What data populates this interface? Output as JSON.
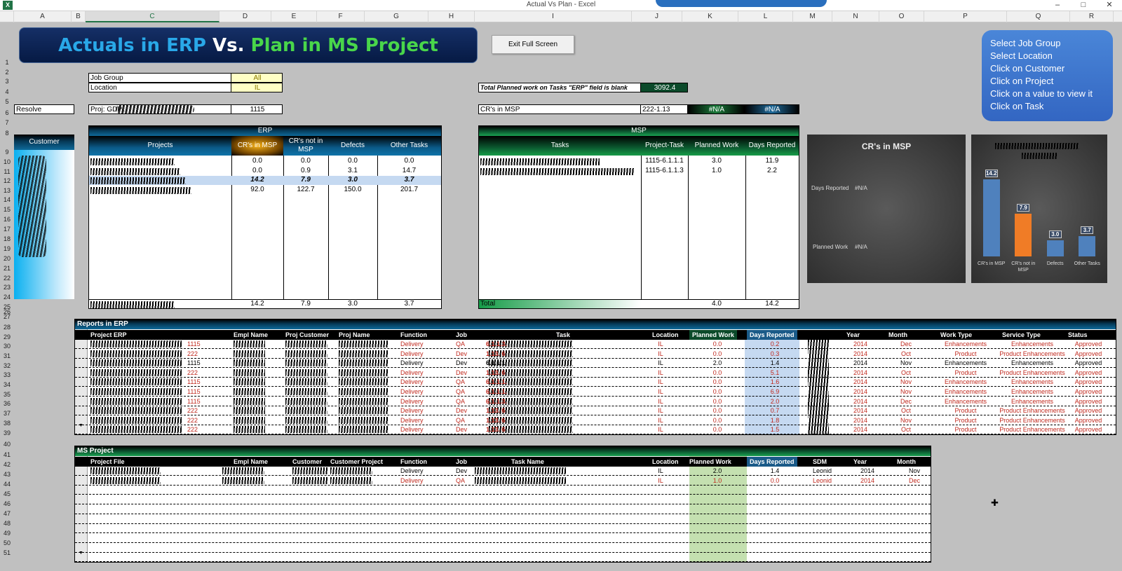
{
  "window": {
    "title": "Actual Vs Plan - Excel"
  },
  "columns": [
    "A",
    "B",
    "C",
    "D",
    "E",
    "F",
    "G",
    "H",
    "I",
    "J",
    "K",
    "L",
    "M",
    "N",
    "O",
    "P",
    "Q",
    "R"
  ],
  "rows": [
    "1",
    "2",
    "3",
    "4",
    "5",
    "6",
    "7",
    "8",
    "9",
    "10",
    "11",
    "12",
    "13",
    "14",
    "15",
    "16",
    "17",
    "18",
    "19",
    "20",
    "21",
    "22",
    "23",
    "24",
    "25",
    "26",
    "27",
    "28",
    "29",
    "30",
    "31",
    "32",
    "33",
    "34",
    "35",
    "36",
    "37",
    "38",
    "39",
    "40",
    "41",
    "42",
    "43",
    "44",
    "45",
    "46",
    "47",
    "48",
    "49",
    "50",
    "51"
  ],
  "banner": {
    "part1": "Actuals in ERP",
    "part2": "Vs.",
    "part3": "Plan in MS Project"
  },
  "exit_button": "Exit Full Screen",
  "instructions": [
    "Select Job Group",
    "Select Location",
    "Click on Customer",
    "Click on Project",
    "Click on a value to view it",
    "Click on Task"
  ],
  "filters": {
    "job_group_label": "Job Group",
    "job_group_value": "All",
    "location_label": "Location",
    "location_value": "IL",
    "row6_a": "Resolve",
    "row6_c": "Proj: GDP...",
    "row6_d": "1115"
  },
  "planned_blank": {
    "label": "Total Planned work on Tasks \"ERP\" field is blank",
    "value": "3092.4"
  },
  "crs_msp": {
    "label": "CR's in MSP",
    "code": "222-1.13",
    "na1": "#N/A",
    "na2": "#N/A"
  },
  "customer_header": "Customer",
  "erp": {
    "group": "ERP",
    "headers": [
      "Projects",
      "CR's in MSP",
      "CR's not in MSP",
      "Defects",
      "Other Tasks"
    ],
    "rows": [
      [
        "0.0",
        "0.0",
        "0.0",
        "0.0"
      ],
      [
        "0.0",
        "0.9",
        "3.1",
        "14.7"
      ],
      [
        "14.2",
        "7.9",
        "3.0",
        "3.7"
      ],
      [
        "92.0",
        "122.7",
        "150.0",
        "201.7"
      ]
    ],
    "totals": [
      "14.2",
      "7.9",
      "3.0",
      "3.7"
    ]
  },
  "msp": {
    "group": "MSP",
    "headers": [
      "Tasks",
      "Project-Task",
      "Planned Work",
      "Days Reported"
    ],
    "rows": [
      [
        "1115-6.1.1.1",
        "3.0",
        "11.9"
      ],
      [
        "1115-6.1.1.3",
        "1.0",
        "2.2"
      ]
    ],
    "total_label": "Total",
    "totals": [
      "4.0",
      "14.2"
    ]
  },
  "chart1": {
    "title": "CR's in MSP",
    "label1": "Days Reported",
    "value1": "#N/A",
    "label2": "Planned Work",
    "value2": "#N/A"
  },
  "chart_data": {
    "type": "bar",
    "categories": [
      "CR's in MSP",
      "CR's not in MSP",
      "Defects",
      "Other Tasks"
    ],
    "values": [
      14.2,
      7.9,
      3.0,
      3.7
    ],
    "colors": [
      "#4f81bd",
      "#f07c26",
      "#4f81bd",
      "#4f81bd"
    ]
  },
  "reports_erp": {
    "title": "Reports in ERP",
    "headers": [
      "Project ERP",
      "Empl Name",
      "Proj Customer",
      "Proj Name",
      "Function",
      "Job",
      "Task",
      "Location",
      "Planned Work",
      "Days Reported",
      "",
      "Year",
      "Month",
      "Work Type",
      "Service Type",
      "Status"
    ],
    "rows": [
      {
        "p": "1115",
        "f": "Delivery",
        "j": "QA",
        "t": "6.1.1.3.",
        "l": "IL",
        "pw": "0.0",
        "dr": "0.2",
        "y": "2014",
        "m": "Dec",
        "wt": "Enhancements",
        "st": "Enhancements",
        "s": "Approved",
        "red": true
      },
      {
        "p": "222",
        "f": "Delivery",
        "j": "Dev",
        "t": "1.13. 6",
        "l": "IL",
        "pw": "0.0",
        "dr": "0.3",
        "y": "2014",
        "m": "Oct",
        "wt": "Product",
        "st": "Product Enhancements",
        "s": "Approved",
        "red": true
      },
      {
        "p": "1115",
        "f": "Delivery",
        "j": "Dev",
        "t": "6.1.1.1.",
        "l": "IL",
        "pw": "2.0",
        "dr": "1.4",
        "y": "2014",
        "m": "Nov",
        "wt": "Enhancements",
        "st": "Enhancements",
        "s": "Approved",
        "red": false
      },
      {
        "p": "222",
        "f": "Delivery",
        "j": "Dev",
        "t": "1.13. 6",
        "l": "IL",
        "pw": "0.0",
        "dr": "5.1",
        "y": "2014",
        "m": "Oct",
        "wt": "Product",
        "st": "Product Enhancements",
        "s": "Approved",
        "red": true
      },
      {
        "p": "1115",
        "f": "Delivery",
        "j": "QA",
        "t": "6.1.1.1.",
        "l": "IL",
        "pw": "0.0",
        "dr": "1.6",
        "y": "2014",
        "m": "Nov",
        "wt": "Enhancements",
        "st": "Enhancements",
        "s": "Approved",
        "red": true
      },
      {
        "p": "1115",
        "f": "Delivery",
        "j": "QA",
        "t": "6.1.1.1.",
        "l": "IL",
        "pw": "0.0",
        "dr": "6.9",
        "y": "2014",
        "m": "Nov",
        "wt": "Enhancements",
        "st": "Enhancements",
        "s": "Approved",
        "red": true
      },
      {
        "p": "1115",
        "f": "Delivery",
        "j": "QA",
        "t": "6.1.1.3.",
        "l": "IL",
        "pw": "0.0",
        "dr": "2.0",
        "y": "2014",
        "m": "Dec",
        "wt": "Enhancements",
        "st": "Enhancements",
        "s": "Approved",
        "red": true
      },
      {
        "p": "222",
        "f": "Delivery",
        "j": "Dev",
        "t": "1.13. 6",
        "l": "IL",
        "pw": "0.0",
        "dr": "0.7",
        "y": "2014",
        "m": "Oct",
        "wt": "Product",
        "st": "Product Enhancements",
        "s": "Approved",
        "red": true
      },
      {
        "p": "222",
        "f": "Delivery",
        "j": "QA",
        "t": "1.13. 6",
        "l": "IL",
        "pw": "0.0",
        "dr": "1.8",
        "y": "2014",
        "m": "Nov",
        "wt": "Product",
        "st": "Product Enhancements",
        "s": "Approved",
        "red": true
      },
      {
        "p": "222",
        "f": "Delivery",
        "j": "Dev",
        "t": "1.13. 6",
        "l": "IL",
        "pw": "0.0",
        "dr": "1.5",
        "y": "2014",
        "m": "Oct",
        "wt": "Product",
        "st": "Product Enhancements",
        "s": "Approved",
        "red": true
      }
    ]
  },
  "ms_project": {
    "title": "MS Project",
    "headers": [
      "Project File",
      "Empl Name",
      "Customer",
      "Customer Project",
      "Function",
      "Job",
      "Task Name",
      "Location",
      "Planned Work",
      "Days Reported",
      "SDM",
      "Year",
      "Month"
    ],
    "rows": [
      {
        "f": "Delivery",
        "j": "Dev",
        "l": "IL",
        "pw": "2.0",
        "dr": "1.4",
        "sdm": "Leonid",
        "y": "2014",
        "m": "Nov",
        "red": false
      },
      {
        "f": "Delivery",
        "j": "QA",
        "l": "IL",
        "pw": "1.0",
        "dr": "0.0",
        "sdm": "Leonid",
        "y": "2014",
        "m": "Dec",
        "red": true
      }
    ]
  }
}
